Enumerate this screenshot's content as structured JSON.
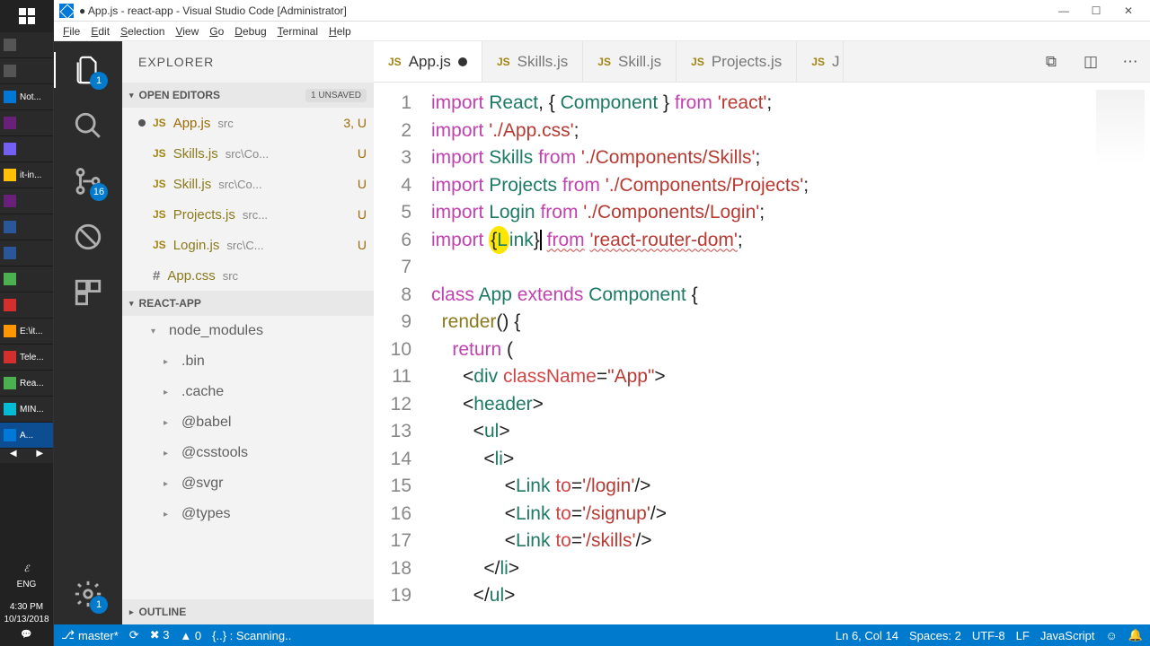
{
  "window": {
    "title": "● App.js - react-app - Visual Studio Code [Administrator]"
  },
  "menubar": [
    "File",
    "Edit",
    "Selection",
    "View",
    "Go",
    "Debug",
    "Terminal",
    "Help"
  ],
  "taskbar": {
    "items": [
      "",
      "",
      "Not...",
      "",
      "",
      "it-in...",
      "",
      "",
      "",
      "",
      "",
      "E:\\it...",
      "Tele...",
      "Rea...",
      "MIN...",
      "A..."
    ],
    "lang": "ENG",
    "time": "4:30 PM",
    "date": "10/13/2018"
  },
  "activitybar": {
    "explorer_badge": "1",
    "scm_badge": "16",
    "gear_badge": "1"
  },
  "sidebar": {
    "title": "EXPLORER",
    "openEditors": {
      "label": "OPEN EDITORS",
      "unsaved": "1 UNSAVED",
      "items": [
        {
          "dot": true,
          "name": "App.js",
          "path": "src",
          "right": "3, U",
          "unsaved": true
        },
        {
          "dot": false,
          "name": "Skills.js",
          "path": "src\\Co...",
          "right": "U"
        },
        {
          "dot": false,
          "name": "Skill.js",
          "path": "src\\Co...",
          "right": "U"
        },
        {
          "dot": false,
          "name": "Projects.js",
          "path": "src...",
          "right": "U"
        },
        {
          "dot": false,
          "name": "Login.js",
          "path": "src\\C...",
          "right": "U"
        },
        {
          "dot": false,
          "name": "App.css",
          "path": "src",
          "right": "",
          "hash": true
        }
      ]
    },
    "project": {
      "label": "REACT-APP",
      "folders": [
        "node_modules",
        ".bin",
        ".cache",
        "@babel",
        "@csstools",
        "@svgr",
        "@types"
      ]
    },
    "outline": "OUTLINE"
  },
  "tabs": {
    "items": [
      {
        "name": "App.js",
        "modified": true,
        "active": true
      },
      {
        "name": "Skills.js"
      },
      {
        "name": "Skill.js"
      },
      {
        "name": "Projects.js"
      },
      {
        "name": "J",
        "cut": true
      }
    ]
  },
  "code": {
    "lineStart": 1,
    "lineEnd": 19
  },
  "statusbar": {
    "branch": "master*",
    "sync": "⟳",
    "errors": "✖ 3",
    "warnings": "▲ 0",
    "scan": "{..} : Scanning..",
    "pos": "Ln 6, Col 14",
    "spaces": "Spaces: 2",
    "enc": "UTF-8",
    "eol": "LF",
    "lang": "JavaScript",
    "smile": "☺",
    "bell": "🔔"
  }
}
